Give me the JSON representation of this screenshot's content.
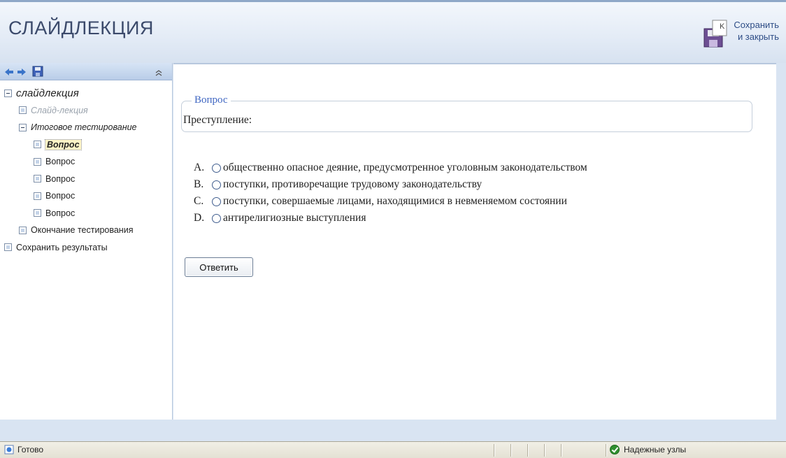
{
  "app": {
    "title": "СЛАЙДЛЕКЦИЯ",
    "save_close_line1": "Сохранить",
    "save_close_line2": "и закрыть"
  },
  "sidebar": {
    "toolbar_icons": [
      "back-arrow-icon",
      "forward-arrow-icon",
      "save-icon",
      "collapse-icon"
    ],
    "tree": [
      {
        "label": "слайдлекция",
        "level": 0
      },
      {
        "label": "Слайд-лекция",
        "level": 1,
        "style": "disabled"
      },
      {
        "label": "Итоговое тестирование",
        "level": 1,
        "style": "italic"
      },
      {
        "label": "Вопрос",
        "level": 2,
        "style": "current"
      },
      {
        "label": "Вопрос",
        "level": 2
      },
      {
        "label": "Вопрос",
        "level": 2
      },
      {
        "label": "Вопрос",
        "level": 2
      },
      {
        "label": "Вопрос",
        "level": 2
      },
      {
        "label": "Окончание тестирования",
        "level": 1
      },
      {
        "label": "Сохранить результаты",
        "level": 0
      }
    ]
  },
  "question": {
    "legend": "Вопрос",
    "text": "Преступление:",
    "answers": [
      {
        "letter": "A.",
        "text": "общественно опасное деяние, предусмотренное уголовным законодательством"
      },
      {
        "letter": "B.",
        "text": "поступки, противоречащие трудовому законодательству"
      },
      {
        "letter": "C.",
        "text": "поступки, совершаемые лицами, находящимися в невменяемом состоянии"
      },
      {
        "letter": "D.",
        "text": "антирелигиозные выступления"
      }
    ],
    "submit_label": "Ответить"
  },
  "statusbar": {
    "status_text": "Готово",
    "zone_text": "Надежные узлы"
  },
  "colors": {
    "accent": "#3f66c2",
    "title": "#3b4a6b",
    "header_bg": "#e3ebf6"
  }
}
